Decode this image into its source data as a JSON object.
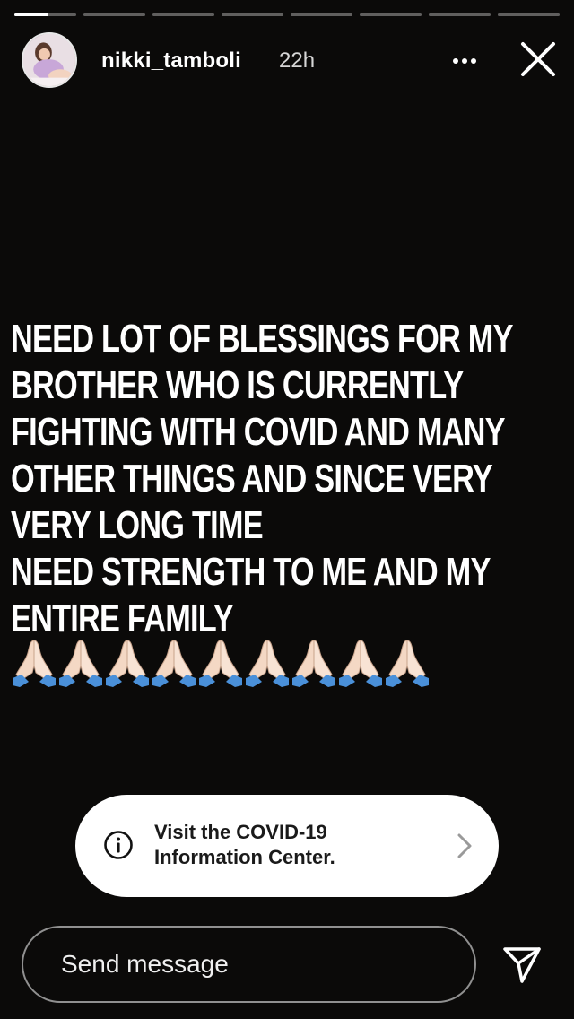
{
  "story": {
    "progress_segments": [
      1,
      1,
      1,
      1,
      1,
      1,
      1,
      1
    ],
    "active_segment_index": 0,
    "active_segment_progress": 0.55
  },
  "header": {
    "username": "nikki_tamboli",
    "time": "22h",
    "more_icon": "more-horizontal-icon",
    "close_icon": "close-icon"
  },
  "message": {
    "lines": [
      "NEED LOT OF BLESSINGS FOR MY",
      "BROTHER WHO IS CURRENTLY",
      "FIGHTING WITH COVID AND MANY",
      "OTHER THINGS AND SINCE VERY",
      "VERY LONG TIME",
      "NEED STRENGTH TO ME AND MY",
      "ENTIRE FAMILY"
    ],
    "emoji": "🙏🏻",
    "emoji_count": 9
  },
  "covid_banner": {
    "line1": "Visit the COVID-19",
    "line2": "Information Center.",
    "icon": "info-icon"
  },
  "footer": {
    "send_placeholder": "Send message",
    "send_icon": "send-icon"
  },
  "colors": {
    "background": "#0b0a09",
    "banner": "#ffffff",
    "text": "#ffffff",
    "sleeve": "#4a90d9",
    "skin": "#f4d8c4"
  }
}
